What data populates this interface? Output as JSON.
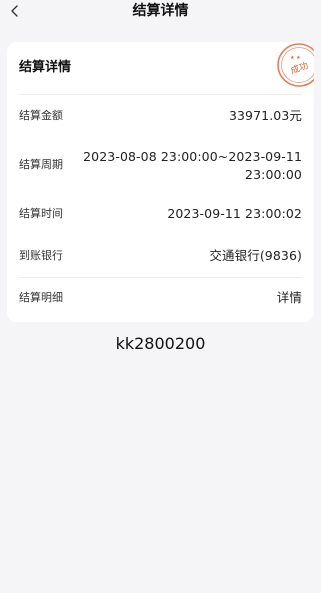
{
  "nav": {
    "title": "结算详情",
    "back_icon": "chevron-left-icon"
  },
  "card": {
    "title": "结算详情",
    "stamp": {
      "text": "成功",
      "color": "#e0663a"
    },
    "rows": [
      {
        "label": "结算金额",
        "value": "33971.03元"
      },
      {
        "label": "结算周期",
        "value_line1": "2023-08-08 23:00:00~2023-09-11",
        "value_line2": "23:00:00"
      },
      {
        "label": "结算时间",
        "value": "2023-09-11 23:00:02"
      },
      {
        "label": "到账银行",
        "value": "交通银行(9836)"
      },
      {
        "label": "结算明细",
        "value": "详情"
      }
    ]
  },
  "footer": {
    "code": "kk2800200"
  },
  "colors": {
    "background": "#f5f5f7",
    "card": "#ffffff",
    "link": "#2f7cf6",
    "stamp": "#e0663a"
  }
}
